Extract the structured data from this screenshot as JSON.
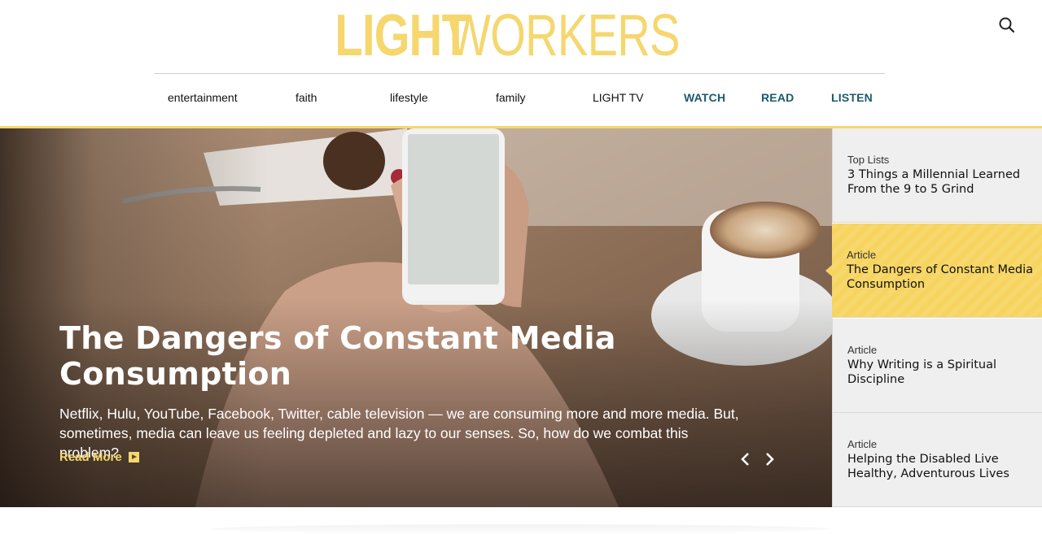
{
  "logo": {
    "bold": "LIGHT",
    "light": "WORKERS"
  },
  "header": {
    "search_icon": "search-icon"
  },
  "nav": [
    {
      "label": "entertainment",
      "accent": false
    },
    {
      "label": "faith",
      "accent": false
    },
    {
      "label": "lifestyle",
      "accent": false
    },
    {
      "label": "family",
      "accent": false
    },
    {
      "label": "LIGHT TV",
      "accent": false
    },
    {
      "label": "WATCH",
      "accent": true
    },
    {
      "label": "READ",
      "accent": true
    },
    {
      "label": "LISTEN",
      "accent": true
    }
  ],
  "hero": {
    "title": "The Dangers of Constant Media Consumption",
    "description": "Netflix, Hulu, YouTube, Facebook, Twitter, cable television — we are consuming more and more media. But, sometimes, media can leave us feeling depleted and lazy to our senses. So, how do we combat this problem?",
    "read_more": "Read More",
    "prev_icon": "chevron-left-icon",
    "next_icon": "chevron-right-icon"
  },
  "sidebar": [
    {
      "category": "Top Lists",
      "title": "3 Things a Millennial Learned From the 9 to 5 Grind",
      "active": false
    },
    {
      "category": "Article",
      "title": "The Dangers of Constant Media Consumption",
      "active": true
    },
    {
      "category": "Article",
      "title": "Why Writing is a Spiritual Discipline",
      "active": false
    },
    {
      "category": "Article",
      "title": "Helping the Disabled Live Healthy, Adventurous Lives",
      "active": false
    }
  ],
  "colors": {
    "brand_yellow": "#f5d76e",
    "nav_accent": "#1b5a6e",
    "sidebar_bg": "#efefef"
  }
}
